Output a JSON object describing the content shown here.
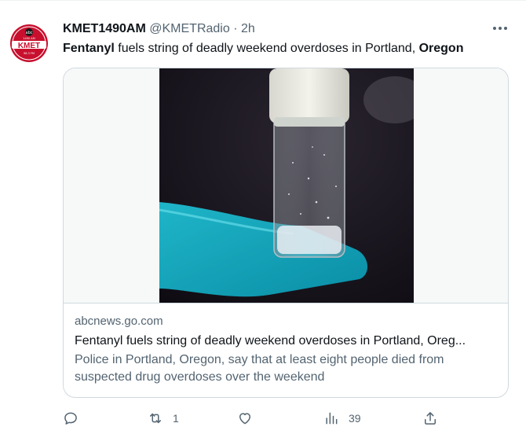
{
  "account": {
    "display_name": "KMET1490AM",
    "handle": "@KMETRadio",
    "separator": "·",
    "time": "2h",
    "avatar": {
      "network_mark": "abc",
      "callsign": "KMET",
      "tagline": "1490 AM",
      "frequency": "98.3 FM"
    }
  },
  "tweet": {
    "bold_start": "Fentanyl",
    "middle": " fuels string of deadly weekend overdoses in Portland, ",
    "bold_end": "Oregon"
  },
  "card": {
    "domain": "abcnews.go.com",
    "title": "Fentanyl fuels string of deadly weekend overdoses in Portland, Oreg...",
    "description": "Police in Portland, Oregon, say that at least eight people died from suspected drug overdoses over the weekend"
  },
  "actions": {
    "reply_count": "",
    "retweet_count": "1",
    "like_count": "",
    "views_count": "39"
  },
  "colors": {
    "accent": "#1d9bf0",
    "muted": "#536471",
    "border": "#cfd9de",
    "avatar_red": "#c8102e"
  },
  "icons": [
    "more-icon",
    "reply-icon",
    "retweet-icon",
    "like-icon",
    "views-icon",
    "share-icon"
  ]
}
